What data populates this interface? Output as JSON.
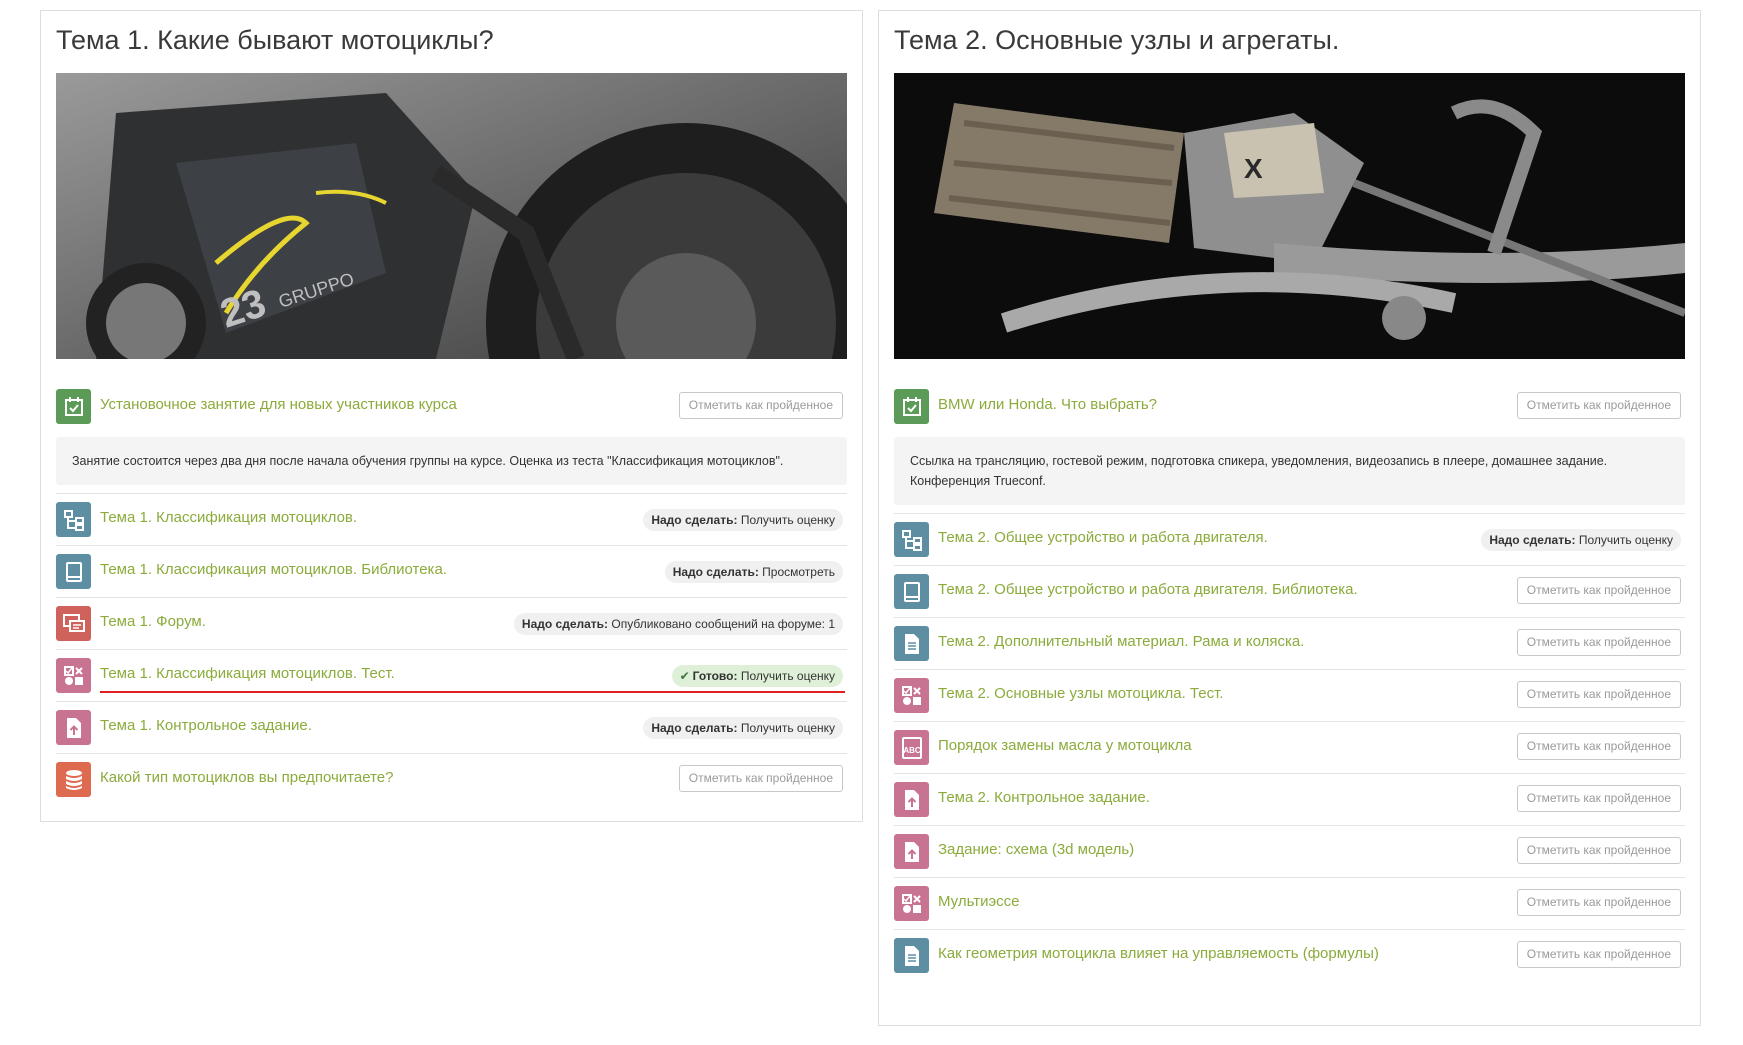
{
  "topics": [
    {
      "title": "Тема 1. Какие бывают мотоциклы?",
      "banner_icon": "motorcycle-photo",
      "first_activity": {
        "title": "Установочное занятие для новых участников курса",
        "icon": "attendance-icon",
        "button": "Отметить как пройденное"
      },
      "description": "Занятие состоится через два дня после начала обучения группы на курсе. Оценка из теста \"Классификация мотоциклов\".",
      "activities": [
        {
          "title": "Тема 1. Классификация мотоциклов.",
          "icon": "lesson-icon",
          "status_prefix": "Надо сделать:",
          "status_text": "Получить оценку"
        },
        {
          "title": "Тема 1. Классификация мотоциклов. Библиотека.",
          "icon": "book-icon",
          "status_prefix": "Надо сделать:",
          "status_text": "Просмотреть"
        },
        {
          "title": "Тема 1. Форум.",
          "icon": "forum-icon",
          "status_prefix": "Надо сделать:",
          "status_text": "Опубликовано сообщений на форуме: 1"
        },
        {
          "title": "Тема 1. Классификация мотоциклов. Тест.",
          "icon": "quiz-icon",
          "status_prefix": "Готово:",
          "status_text": "Получить оценку",
          "status_check": "✔"
        },
        {
          "title": "Тема 1. Контрольное задание.",
          "icon": "assignment-icon",
          "status_prefix": "Надо сделать:",
          "status_text": "Получить оценку"
        },
        {
          "title": "Какой тип мотоциклов вы предпочитаете?",
          "icon": "database-icon",
          "button": "Отметить как пройденное"
        }
      ]
    },
    {
      "title": "Тема 2. Основные узлы и агрегаты.",
      "banner_icon": "handlebar-photo",
      "first_activity": {
        "title": "BMW или Honda. Что выбрать?",
        "icon": "attendance-icon",
        "button": "Отметить как пройденное"
      },
      "description": "Ссылка на трансляцию, гостевой режим, подготовка спикера, уведомления, видеозапись в плеере, домашнее задание. Конференция Trueconf.",
      "activities": [
        {
          "title": "Тема 2. Общее устройство и работа двигателя.",
          "icon": "lesson-icon",
          "status_prefix": "Надо сделать:",
          "status_text": "Получить оценку"
        },
        {
          "title": "Тема 2. Общее устройство и работа двигателя. Библиотека.",
          "icon": "book-icon",
          "button": "Отметить как пройденное"
        },
        {
          "title": "Тема 2. Дополнительный материал. Рама и коляска.",
          "icon": "page-icon",
          "button": "Отметить как пройденное"
        },
        {
          "title": "Тема 2. Основные узлы мотоцикла. Тест.",
          "icon": "quiz-icon",
          "button": "Отметить как пройденное"
        },
        {
          "title": "Порядок замены масла у мотоцикла",
          "icon": "glossary-abc-icon",
          "button": "Отметить как пройденное"
        },
        {
          "title": "Тема 2. Контрольное задание.",
          "icon": "assignment-icon",
          "button": "Отметить как пройденное"
        },
        {
          "title": "Задание: схема (3d модель)",
          "icon": "assignment-icon",
          "button": "Отметить как пройденное"
        },
        {
          "title": "Мультиэссе",
          "icon": "quiz-icon",
          "button": "Отметить как пройденное"
        },
        {
          "title": "Как геометрия мотоцикла влияет на управляемость (формулы)",
          "icon": "page-icon",
          "button": "Отметить как пройденное"
        }
      ]
    }
  ],
  "icon_label_abc": "ABC",
  "colors": {
    "link": "#8bab3b",
    "green": "#5b9b57",
    "teal": "#5d8ea2",
    "red": "#d0625c",
    "pink": "#c87391",
    "orange": "#de6b4f",
    "highlight_underline": "#e02020"
  }
}
